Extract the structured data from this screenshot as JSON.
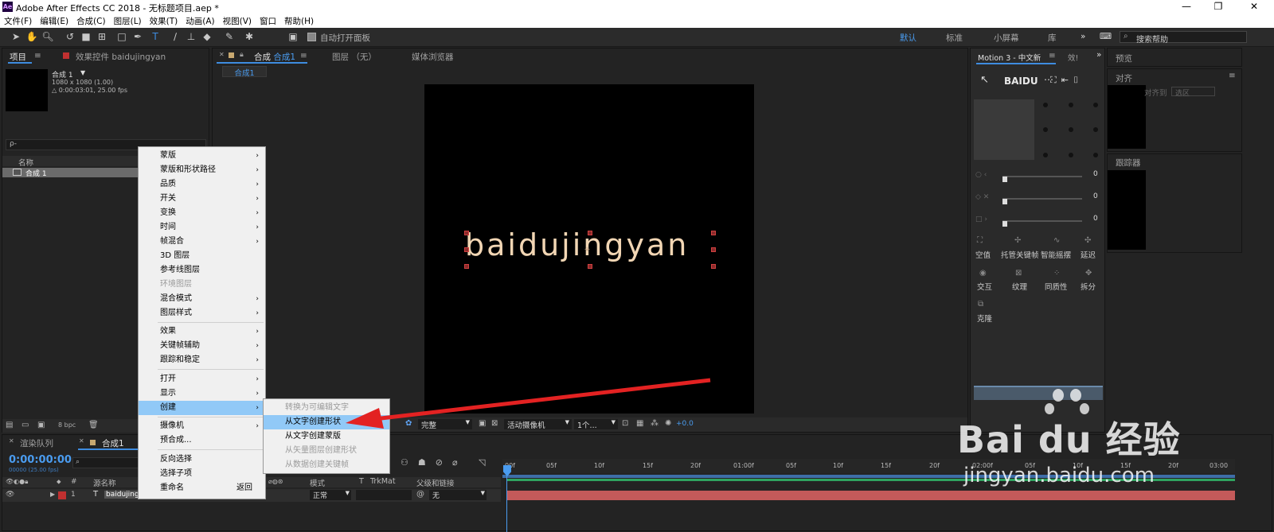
{
  "app": {
    "title": "Adobe After Effects CC 2018 - 无标题项目.aep *",
    "logo": "Ae"
  },
  "window_controls": {
    "minimize": "—",
    "restore": "❐",
    "close": "✕"
  },
  "menubar": [
    "文件(F)",
    "编辑(E)",
    "合成(C)",
    "图层(L)",
    "效果(T)",
    "动画(A)",
    "视图(V)",
    "窗口",
    "帮助(H)"
  ],
  "toolbar": {
    "auto_open_label": "自动打开面板",
    "workspaces": [
      "默认",
      "标准",
      "小屏幕",
      "库"
    ],
    "search_placeholder": "搜索帮助"
  },
  "project_panel": {
    "tab_project": "项目",
    "tab_effects": "效果控件 baidujingyan",
    "comp_name": "合成 1",
    "comp_size": "1080 x 1080 (1.00)",
    "comp_duration": "△ 0:00:03:01, 25.00 fps",
    "search_icon": "ρ-",
    "col_name": "名称",
    "item": "合成 1",
    "bpc": "8 bpc"
  },
  "comp_panel": {
    "tab_comp": "合成",
    "tab_comp_name": "合成1",
    "tab_layer": "图层 （无）",
    "tab_media": "媒体浏览器",
    "breadcrumb": "合成1",
    "canvas_text": "baidujingyan",
    "quality": "完整",
    "camera": "活动摄像机",
    "views": "1个...",
    "exposure": "+0.0"
  },
  "context_menu": {
    "items": [
      {
        "label": "蒙版",
        "submenu": true,
        "disabled": false
      },
      {
        "label": "蒙版和形状路径",
        "submenu": true,
        "disabled": false
      },
      {
        "label": "品质",
        "submenu": true,
        "disabled": false
      },
      {
        "label": "开关",
        "submenu": true,
        "disabled": false
      },
      {
        "label": "变换",
        "submenu": true,
        "disabled": false
      },
      {
        "label": "时间",
        "submenu": true,
        "disabled": false
      },
      {
        "label": "帧混合",
        "submenu": true,
        "disabled": false
      },
      {
        "label": "3D 图层",
        "submenu": false,
        "disabled": false
      },
      {
        "label": "参考线图层",
        "submenu": false,
        "disabled": false
      },
      {
        "label": "环境图层",
        "submenu": false,
        "disabled": true
      },
      {
        "label": "混合模式",
        "submenu": true,
        "disabled": false
      },
      {
        "label": "图层样式",
        "submenu": true,
        "disabled": false
      },
      {
        "label": "效果",
        "submenu": true,
        "disabled": false
      },
      {
        "label": "关键帧辅助",
        "submenu": true,
        "disabled": false
      },
      {
        "label": "跟踪和稳定",
        "submenu": true,
        "disabled": false
      },
      {
        "label": "打开",
        "submenu": true,
        "disabled": false
      },
      {
        "label": "显示",
        "submenu": true,
        "disabled": false
      },
      {
        "label": "创建",
        "submenu": true,
        "disabled": false,
        "highlighted": true
      },
      {
        "label": "摄像机",
        "submenu": true,
        "disabled": false
      },
      {
        "label": "预合成...",
        "submenu": false,
        "disabled": false
      },
      {
        "label": "反向选择",
        "submenu": false,
        "disabled": false
      },
      {
        "label": "选择子项",
        "submenu": false,
        "disabled": false
      },
      {
        "label": "重命名",
        "submenu": false,
        "disabled": false,
        "shortcut": "返回"
      }
    ]
  },
  "submenu_create": {
    "items": [
      {
        "label": "转换为可编辑文字",
        "disabled": true
      },
      {
        "label": "从文字创建形状",
        "disabled": false,
        "highlighted": true
      },
      {
        "label": "从文字创建蒙版",
        "disabled": false
      },
      {
        "label": "从矢量图层创建形状",
        "disabled": true
      },
      {
        "label": "从数据创建关键帧",
        "disabled": true
      }
    ]
  },
  "motion_panel": {
    "tab": "Motion 3 - 中文新",
    "tab_effects": "效!",
    "brand": "BAIDU",
    "slider_values": [
      "0",
      "0",
      "0"
    ],
    "buttons_row1": [
      "空值",
      "托管关键帧",
      "智能摇摆",
      "延迟"
    ],
    "buttons_row2": [
      "交互",
      "纹理",
      "同质性",
      "拆分"
    ],
    "buttons_row3": [
      "克隆"
    ]
  },
  "right_panels": {
    "preview": "预览",
    "align": "对齐",
    "align_to": "对齐到",
    "align_to_value": "选区",
    "tracker": "跟踪器"
  },
  "timeline": {
    "tab_render": "渲染队列",
    "tab_comp": "合成1",
    "timecode": "0:00:00:00",
    "fps": "00000 (25.00 fps)",
    "col_source": "源名称",
    "col_mode": "模式",
    "col_t": "T",
    "col_trkmat": "TrkMat",
    "col_parent": "父级和链接",
    "layer_num": "1",
    "layer_type": "T",
    "layer_name": "baidujingyan",
    "layer_mode": "正常",
    "layer_parent": "无",
    "ruler": [
      "00f",
      "05f",
      "10f",
      "15f",
      "20f",
      "01:00f",
      "05f",
      "10f",
      "15f",
      "20f",
      "02:00f",
      "05f",
      "10f",
      "15f",
      "20f",
      "03:00"
    ]
  },
  "watermark": {
    "text": "Bai du 经验",
    "url": "jingyan.baidu.com"
  },
  "colors": {
    "accent": "#3e8ce0",
    "menu_highlight": "#91c9f7",
    "canvas_text": "#f2d6b4",
    "layer_bar": "#c45a5a",
    "arrow": "#e32222"
  }
}
